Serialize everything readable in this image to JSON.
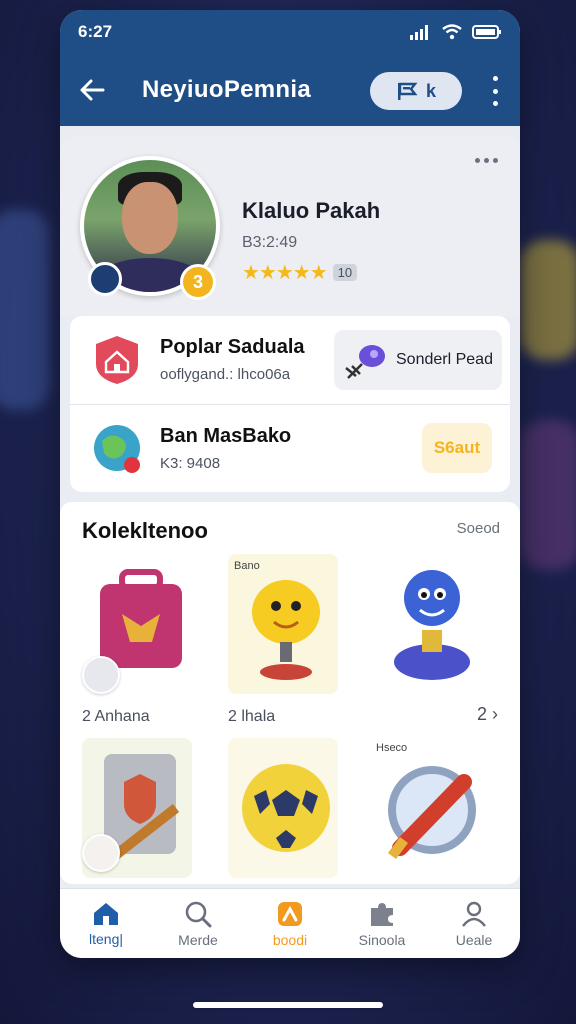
{
  "status_bar": {
    "time": "6:27"
  },
  "app_bar": {
    "title": "NeyiuoPemnia",
    "pill_label": "k"
  },
  "profile": {
    "name": "Klaluo Pakah",
    "subtitle": "B3:2:49",
    "stars": "★★★★★",
    "rating_badge": "10",
    "level_badge": "3"
  },
  "rows": [
    {
      "title": "Poplar Saduala",
      "subtitle": "ooflygand.: lhco06a",
      "action_label": "Sonderl Pead"
    },
    {
      "title": "Ban MasBako",
      "subtitle": "K3: 9408",
      "pill_label": "S6aut"
    }
  ],
  "collection": {
    "title": "Kolekltenoo",
    "link": "Soeod",
    "tiles": [
      {
        "label": "2 Anhana",
        "tag": ""
      },
      {
        "label": "2 lhala",
        "tag": "Bano"
      },
      {
        "label": "",
        "tag": ""
      },
      {
        "label": "",
        "tag": ""
      },
      {
        "label": "",
        "tag": ""
      },
      {
        "label": "",
        "tag": "Hseco"
      }
    ],
    "more": "2 ›"
  },
  "bottom_nav": [
    {
      "label": "lteng|",
      "icon": "home-icon"
    },
    {
      "label": "Merde",
      "icon": "search-icon"
    },
    {
      "label": "boodi",
      "icon": "trophy-icon"
    },
    {
      "label": "Sinoola",
      "icon": "puzzle-icon"
    },
    {
      "label": "Ueale",
      "icon": "profile-icon"
    }
  ],
  "colors": {
    "primary": "#1f4d86",
    "accent": "#f29a1f",
    "star": "#f4b81a",
    "active_nav": "#1f5ea8"
  }
}
